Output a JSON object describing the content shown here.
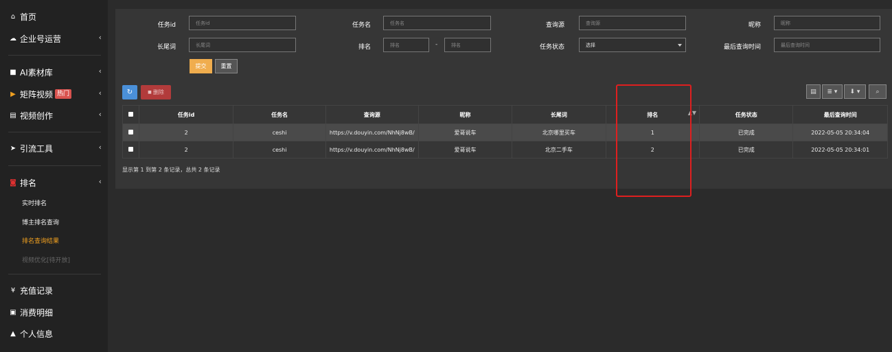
{
  "sidebar": {
    "items": [
      {
        "icon": "home-icon",
        "glyph": "⌂",
        "label": "首页"
      },
      {
        "icon": "cloud-icon",
        "glyph": "☁",
        "label": "企业号运营"
      },
      {
        "icon": "folder-icon",
        "glyph": "■",
        "label": "AI素材库"
      },
      {
        "icon": "video-icon",
        "glyph": "▶",
        "label": "矩阵视频",
        "badge": "热门"
      },
      {
        "icon": "film-icon",
        "glyph": "▤",
        "label": "视频创作"
      },
      {
        "icon": "send-icon",
        "glyph": "➤",
        "label": "引流工具"
      },
      {
        "icon": "chart-icon",
        "glyph": "◙",
        "label": "排名"
      },
      {
        "icon": "yen-icon",
        "glyph": "¥",
        "label": "充值记录"
      },
      {
        "icon": "money-icon",
        "glyph": "▣",
        "label": "消费明细"
      },
      {
        "icon": "user-icon",
        "glyph": "▲",
        "label": "个人信息"
      }
    ],
    "rank_sub": [
      "实时排名",
      "博主排名查询",
      "排名查询结果",
      "视频优化[待开放]"
    ],
    "chevron": "‹"
  },
  "filters": {
    "task_id": {
      "label": "任务id",
      "placeholder": "任务id"
    },
    "task_name": {
      "label": "任务名",
      "placeholder": "任务名"
    },
    "source": {
      "label": "查询源",
      "placeholder": "查询源"
    },
    "nickname": {
      "label": "昵称",
      "placeholder": "昵称"
    },
    "keyword": {
      "label": "长尾词",
      "placeholder": "长尾词"
    },
    "rank": {
      "label": "排名",
      "placeholder_from": "排名",
      "placeholder_to": "排名",
      "separator": "-"
    },
    "status": {
      "label": "任务状态",
      "value": "选择"
    },
    "last_time": {
      "label": "最后查询时间",
      "placeholder": "最后查询时间"
    },
    "submit": "提交",
    "reset": "重置"
  },
  "toolbar": {
    "refresh_glyph": "↻",
    "delete_label": "删除",
    "delete_glyph": "■",
    "tools": [
      "▤",
      "≣ ▾",
      "⬇ ▾",
      "⌕"
    ]
  },
  "table": {
    "columns": [
      "任务id",
      "任务名",
      "查询源",
      "昵称",
      "长尾词",
      "排名",
      "任务状态",
      "最后查询时间"
    ],
    "rows": [
      {
        "id": "2",
        "name": "ceshi",
        "source": "https://v.douyin.com/NhNj8wB/",
        "nickname": "爱哥说车",
        "keyword": "北京哪里买车",
        "rank": "1",
        "status": "已完成",
        "time": "2022-05-05 20:34:04"
      },
      {
        "id": "2",
        "name": "ceshi",
        "source": "https://v.douyin.com/NhNj8wB/",
        "nickname": "爱哥说车",
        "keyword": "北京二手车",
        "rank": "2",
        "status": "已完成",
        "time": "2022-05-05 20:34:01"
      }
    ],
    "sort_glyph": "▲▼"
  },
  "summary": "显示第 1 到第 2 条记录，总共 2 条记录",
  "colors": {
    "accent": "#f0ad4e",
    "highlight": "#e01f1f",
    "sidebar_bg": "#222222",
    "panel_bg": "#363636"
  }
}
